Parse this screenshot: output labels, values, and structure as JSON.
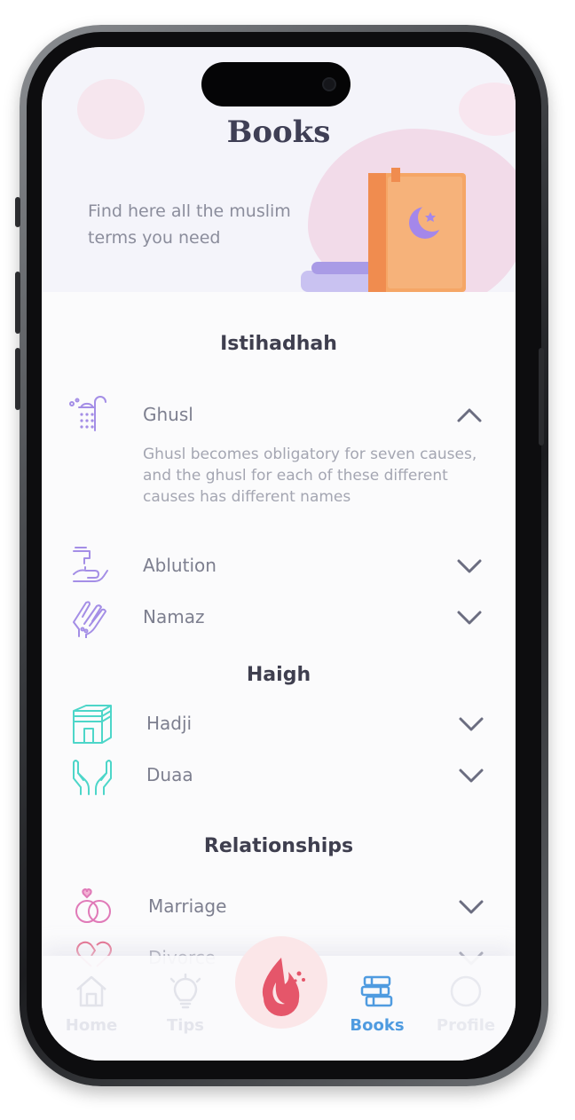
{
  "header": {
    "title": "Books",
    "subtitle": "Find here all the muslim terms you need"
  },
  "sections": [
    {
      "title": "Istihadhah",
      "items": [
        {
          "icon": "shower-icon",
          "label": "Ghusl",
          "expanded": true,
          "description": "Ghusl becomes obligatory for seven causes, and the ghusl for each of these different causes has different names"
        },
        {
          "icon": "faucet-hands-icon",
          "label": "Ablution",
          "expanded": false
        },
        {
          "icon": "praying-hands-icon",
          "label": "Namaz",
          "expanded": false
        }
      ]
    },
    {
      "title": "Haigh",
      "items": [
        {
          "icon": "kaaba-icon",
          "label": "Hadji",
          "expanded": false
        },
        {
          "icon": "open-hands-icon",
          "label": "Duaa",
          "expanded": false
        }
      ]
    },
    {
      "title": "Relationships",
      "items": [
        {
          "icon": "rings-icon",
          "label": "Marriage",
          "expanded": false
        },
        {
          "icon": "broken-heart-icon",
          "label": "Divorce",
          "expanded": false
        }
      ]
    }
  ],
  "nav": {
    "items": [
      {
        "icon": "home-icon",
        "label": "Home",
        "active": false
      },
      {
        "icon": "lightbulb-icon",
        "label": "Tips",
        "active": false
      },
      {
        "icon": "drop-logo-icon",
        "label": "",
        "active": false
      },
      {
        "icon": "books-icon",
        "label": "Books",
        "active": true
      },
      {
        "icon": "profile-icon",
        "label": "Profile",
        "active": false
      }
    ]
  },
  "colors": {
    "accent_blue": "#4f9be0",
    "icon_purple": "#a48ee6",
    "icon_teal": "#4dd6c9",
    "icon_pink": "#e07ab8",
    "logo_red": "#e25563",
    "text_dark": "#3f3f4f",
    "text_muted": "#7d7f8f"
  }
}
